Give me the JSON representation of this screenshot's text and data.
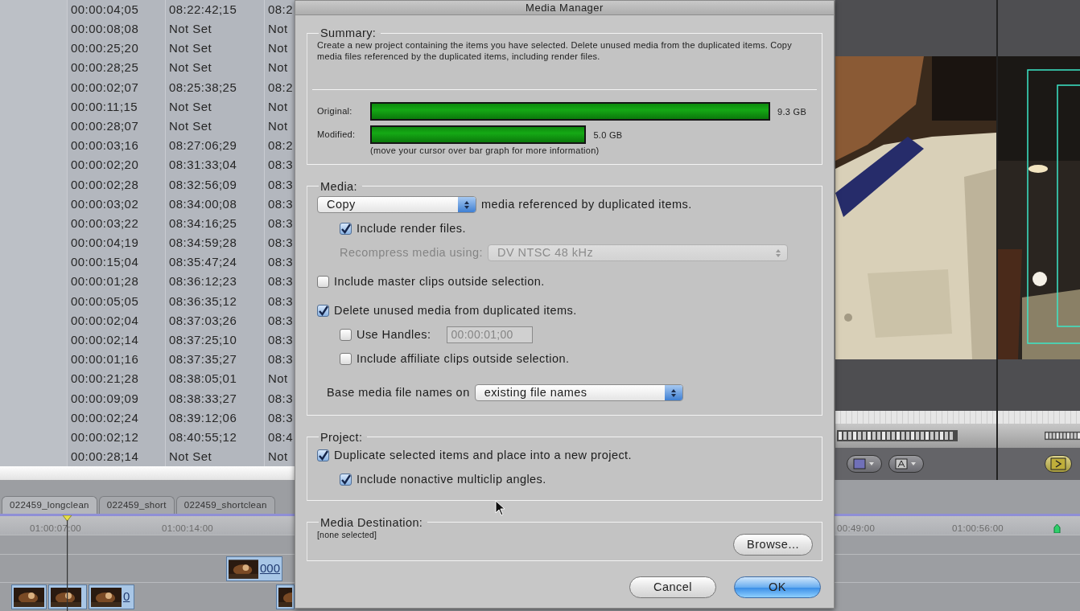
{
  "browser": {
    "rows": [
      {
        "duration": "00:00:04;05",
        "in": "08:22:42;15",
        "column_3": "08:2"
      },
      {
        "duration": "00:00:08;08",
        "in": "Not Set",
        "column_3": "Not"
      },
      {
        "duration": "00:00:25;20",
        "in": "Not Set",
        "column_3": "Not"
      },
      {
        "duration": "00:00:28;25",
        "in": "Not Set",
        "column_3": "Not"
      },
      {
        "duration": "00:00:02;07",
        "in": "08:25:38;25",
        "column_3": "08:2"
      },
      {
        "duration": "00:00:11;15",
        "in": "Not Set",
        "column_3": "Not"
      },
      {
        "duration": "00:00:28;07",
        "in": "Not Set",
        "column_3": "Not"
      },
      {
        "duration": "00:00:03;16",
        "in": "08:27:06;29",
        "column_3": "08:2"
      },
      {
        "duration": "00:00:02;20",
        "in": "08:31:33;04",
        "column_3": "08:3"
      },
      {
        "duration": "00:00:02;28",
        "in": "08:32:56;09",
        "column_3": "08:3"
      },
      {
        "duration": "00:00:03;02",
        "in": "08:34:00;08",
        "column_3": "08:3"
      },
      {
        "duration": "00:00:03;22",
        "in": "08:34:16;25",
        "column_3": "08:3"
      },
      {
        "duration": "00:00:04;19",
        "in": "08:34:59;28",
        "column_3": "08:3"
      },
      {
        "duration": "00:00:15;04",
        "in": "08:35:47;24",
        "column_3": "08:3"
      },
      {
        "duration": "00:00:01;28",
        "in": "08:36:12;23",
        "column_3": "08:3"
      },
      {
        "duration": "00:00:05;05",
        "in": "08:36:35;12",
        "column_3": "08:3"
      },
      {
        "duration": "00:00:02;04",
        "in": "08:37:03;26",
        "column_3": "08:3"
      },
      {
        "duration": "00:00:02;14",
        "in": "08:37:25;10",
        "column_3": "08:3"
      },
      {
        "duration": "00:00:01;16",
        "in": "08:37:35;27",
        "column_3": "08:3"
      },
      {
        "duration": "00:00:21;28",
        "in": "08:38:05;01",
        "column_3": "Not"
      },
      {
        "duration": "00:00:09;09",
        "in": "08:38:33;27",
        "column_3": "08:3"
      },
      {
        "duration": "00:00:02;24",
        "in": "08:39:12;06",
        "column_3": "08:3"
      },
      {
        "duration": "00:00:02;12",
        "in": "08:40:55;12",
        "column_3": "08:4"
      },
      {
        "duration": "00:00:28;14",
        "in": "Not Set",
        "column_3": "Not"
      }
    ]
  },
  "timeline": {
    "tabs": [
      {
        "label": "022459_longclean",
        "selected": true
      },
      {
        "label": "022459_short",
        "selected": false
      },
      {
        "label": "022459_shortclean",
        "selected": false
      }
    ],
    "ruler_labels": [
      "01:00:07:00",
      "01:00:14:00",
      "00:49:00",
      "01:00:56:00"
    ],
    "tracks": [
      {
        "clip_labels": [
          "000"
        ]
      },
      {
        "clip_labels": [
          "0"
        ]
      }
    ]
  },
  "dialog": {
    "title": "Media Manager",
    "summary": {
      "heading": "Summary:",
      "text": "Create a new project containing the items you have selected. Delete unused media from the duplicated items. Copy media files referenced by the duplicated items, including render files.",
      "bars": [
        {
          "label": "Original:",
          "level": 1.0,
          "reading": "9.3 GB"
        },
        {
          "label": "Modified:",
          "level": 0.54,
          "reading": "5.0 GB"
        }
      ],
      "note": "(move your cursor over bar graph for more information)"
    },
    "media": {
      "heading": "Media:",
      "items": [
        {
          "kind": "action",
          "value": "Copy",
          "text": "media referenced by duplicated items.",
          "children": [
            {
              "kind": "checkbox",
              "label": "Include render files.",
              "checked": true
            },
            {
              "kind": "select",
              "label": "Recompress media using:",
              "value": "DV NTSC 48 kHz",
              "disabled": true
            }
          ]
        },
        {
          "kind": "checkbox",
          "label": "Include master clips outside selection.",
          "checked": false
        },
        {
          "kind": "checkbox",
          "label": "Delete unused media from duplicated items.",
          "checked": true,
          "children": [
            {
              "kind": "checkbox_field",
              "label": "Use Handles:",
              "checked": false,
              "value": "00:00:01;00",
              "disabled": true
            },
            {
              "kind": "checkbox",
              "label": "Include affiliate clips outside selection.",
              "checked": false
            }
          ]
        },
        {
          "kind": "select",
          "label": "Base media file names on",
          "value": "existing file names",
          "disabled": false
        }
      ]
    },
    "project": {
      "heading": "Project:",
      "items": [
        {
          "kind": "checkbox",
          "label": "Duplicate selected items and place into a new project.",
          "checked": true,
          "children": [
            {
              "kind": "checkbox",
              "label": "Include nonactive multiclip angles.",
              "checked": true
            }
          ]
        }
      ]
    },
    "destination": {
      "heading": "Media Destination:",
      "path": "[none selected]",
      "button": "Browse..."
    },
    "buttons": [
      {
        "label": "Cancel",
        "default": false
      },
      {
        "label": "OK",
        "default": true
      }
    ]
  }
}
